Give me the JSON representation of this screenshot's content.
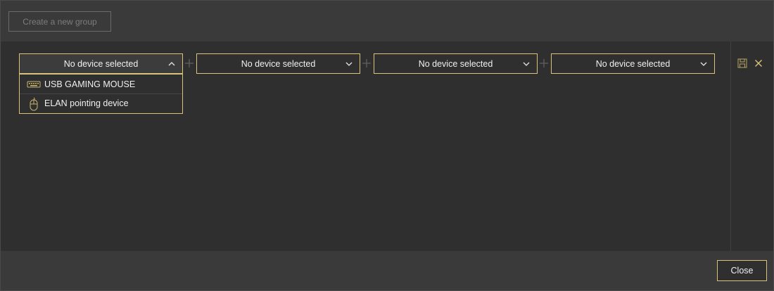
{
  "topbar": {
    "create_group_label": "Create a new group"
  },
  "device_slots": [
    {
      "label": "No device selected",
      "expanded": true
    },
    {
      "label": "No device selected",
      "expanded": false
    },
    {
      "label": "No device selected",
      "expanded": false
    },
    {
      "label": "No device selected",
      "expanded": false
    }
  ],
  "dropdown_options": [
    {
      "label": "USB GAMING MOUSE",
      "icon": "keyboard-icon"
    },
    {
      "label": "ELAN pointing device",
      "icon": "mouse-icon"
    }
  ],
  "side_actions": {
    "save_icon": "save-icon",
    "remove_icon": "close-icon"
  },
  "footer": {
    "close_label": "Close"
  },
  "colors": {
    "accent": "#d9c27a",
    "background": "#2f2f2f",
    "bar": "#3a3a3a",
    "muted_text": "#7d7d7d"
  }
}
